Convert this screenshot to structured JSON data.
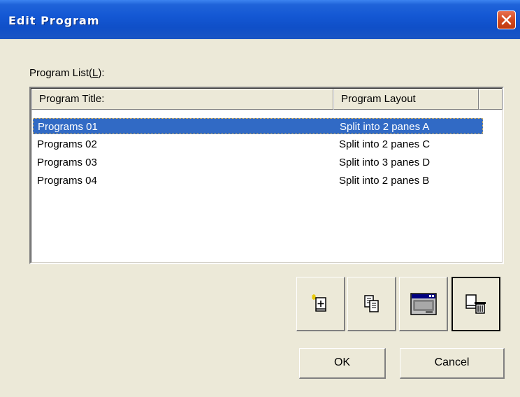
{
  "window": {
    "title": "Edit Program"
  },
  "list": {
    "label_prefix": "Program List(",
    "label_key": "L",
    "label_suffix": "):",
    "columns": [
      "Program Title:",
      "Program Layout"
    ],
    "rows": [
      {
        "title": "Programs 01",
        "layout": "Split into 2 panes A",
        "selected": true
      },
      {
        "title": "Programs 02",
        "layout": "Split into 2 panes C",
        "selected": false
      },
      {
        "title": "Programs 03",
        "layout": "Split into 3 panes D",
        "selected": false
      },
      {
        "title": "Programs 04",
        "layout": "Split into 2 panes B",
        "selected": false
      }
    ]
  },
  "toolbar": {
    "icons": [
      "new-program-icon",
      "copy-program-icon",
      "edit-layout-icon",
      "delete-program-icon"
    ]
  },
  "buttons": {
    "ok": "OK",
    "cancel": "Cancel"
  },
  "colors": {
    "selection": "#316ac5",
    "titlebar": "#1458d4",
    "dialog_bg": "#ece9d8"
  }
}
